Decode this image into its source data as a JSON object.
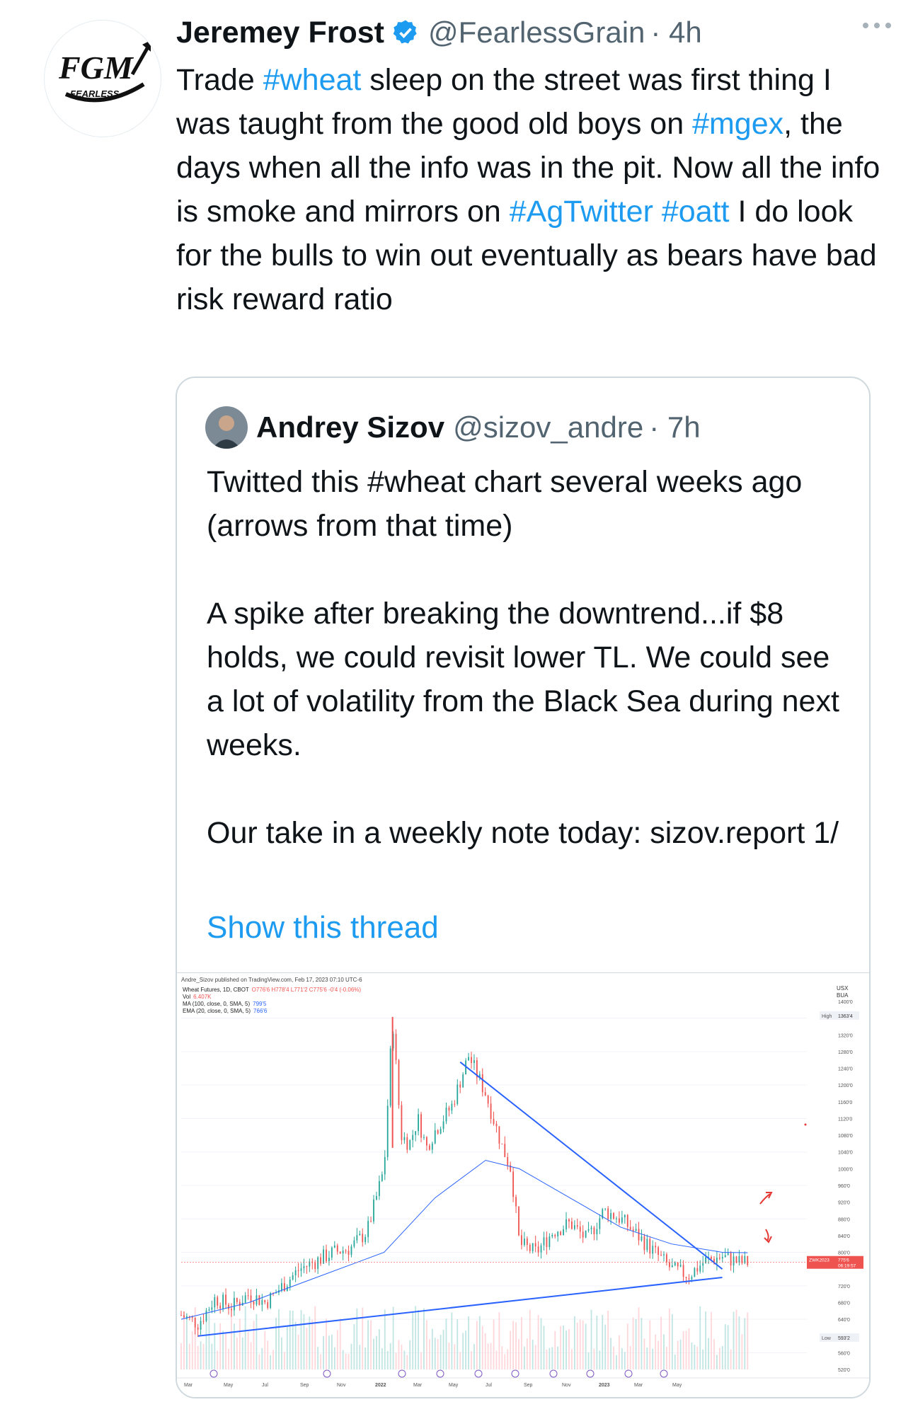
{
  "tweet": {
    "author_name": "Jeremey Frost",
    "author_handle": "@FearlessGrain",
    "time": "· 4h",
    "avatar_logo": {
      "line1": "FGM",
      "line2": "FEARLESS"
    },
    "text_segments": [
      {
        "t": "Trade ",
        "tag": false
      },
      {
        "t": "#wheat",
        "tag": true
      },
      {
        "t": " sleep on the street was first thing I was taught from the good old boys on ",
        "tag": false
      },
      {
        "t": "#mgex",
        "tag": true
      },
      {
        "t": ", the days when all the info was in the pit.  Now all the info is smoke and mirrors on ",
        "tag": false
      },
      {
        "t": "#AgTwitter",
        "tag": true
      },
      {
        "t": " ",
        "tag": false
      },
      {
        "t": "#oatt",
        "tag": true
      },
      {
        "t": " I do look for the bulls to win out eventually as bears have bad risk reward ratio",
        "tag": false
      }
    ],
    "colors": {
      "link": "#1d9bf0",
      "verified": "#1d9bf0",
      "muted": "#536471"
    }
  },
  "quote": {
    "author_name": "Andrey Sizov",
    "author_handle": "@sizov_andre",
    "time": "· 7h",
    "paragraphs": [
      "Twitted this #wheat chart several weeks ago (arrows from that time)",
      "A spike after breaking the downtrend...if $8 holds, we could revisit lower TL. We could see a lot of volatility from the Black Sea during next weeks.",
      "Our take in a weekly note today: sizov.report  1/"
    ],
    "show_thread": "Show this thread"
  },
  "chart_data": {
    "type": "line",
    "header": {
      "published": "Andre_Sizov published on TradingView.com, Feb 17, 2023 07:10 UTC-6",
      "line1_prefix": "Wheat Futures, 1D, CBOT",
      "line1_ohlc": "O776'6 H778'4 L771'2 C775'6 -0'4 (-0.06%)",
      "vol_label": "Vol",
      "vol_value": "6.407K",
      "ma_label": "MA (100, close, 0, SMA, 5)",
      "ma_value": "799'5",
      "ema_label": "EMA (20, close, 0, SMA, 5)",
      "ema_value": "766'6",
      "currency": "USX",
      "unit": "BUA"
    },
    "y_ticks": [
      "1400'0",
      "1320'0",
      "1280'0",
      "1240'0",
      "1200'0",
      "1160'0",
      "1120'0",
      "1080'0",
      "1040'0",
      "1000'0",
      "960'0",
      "920'0",
      "880'0",
      "840'0",
      "800'0",
      "720'0",
      "680'0",
      "640'0",
      "560'0",
      "520'0"
    ],
    "high_label": "High",
    "high_value": "1363'4",
    "low_label": "Low",
    "low_value": "593'2",
    "price_tag": {
      "symbol": "ZWK2023",
      "price": "775'6",
      "countdown": "06:19:57"
    },
    "x_labels": [
      "Mar",
      "May",
      "Jul",
      "Sep",
      "Nov",
      "2022",
      "Mar",
      "May",
      "Jul",
      "Sep",
      "Nov",
      "2023",
      "Mar",
      "May"
    ],
    "ylim": [
      520,
      1400
    ],
    "price_series": {
      "name": "Wheat Futures",
      "x": [
        0,
        2,
        4,
        6,
        8,
        10,
        12,
        14,
        16,
        18,
        20,
        22,
        24,
        25,
        26,
        27,
        28,
        29,
        30,
        32,
        34,
        36,
        38,
        39,
        40,
        42,
        44,
        46,
        48,
        50,
        52,
        54,
        56,
        58,
        60,
        62,
        64,
        66,
        68
      ],
      "values": [
        650,
        630,
        690,
        670,
        700,
        680,
        720,
        760,
        780,
        800,
        810,
        850,
        1000,
        1363,
        1080,
        1060,
        1120,
        1050,
        1090,
        1150,
        1270,
        1180,
        1050,
        1000,
        820,
        800,
        850,
        870,
        830,
        900,
        880,
        840,
        800,
        760,
        745,
        780,
        790,
        776,
        776
      ]
    },
    "ma_series": {
      "name": "MA (100, close, 0, SMA, 5)",
      "x": [
        0,
        8,
        16,
        24,
        30,
        36,
        40,
        46,
        52,
        58,
        64,
        67
      ],
      "values": [
        640,
        680,
        740,
        800,
        930,
        1020,
        1000,
        930,
        860,
        820,
        800,
        799
      ]
    },
    "upper_trendline": {
      "x": [
        33,
        64
      ],
      "values": [
        1255,
        760
      ]
    },
    "lower_trendline": {
      "x": [
        2,
        64
      ],
      "values": [
        600,
        740
      ]
    },
    "colors": {
      "up": "#26a69a",
      "down": "#ef5350",
      "trend": "#2962ff",
      "ma": "#2962ff",
      "tag": "#ef5350"
    }
  }
}
